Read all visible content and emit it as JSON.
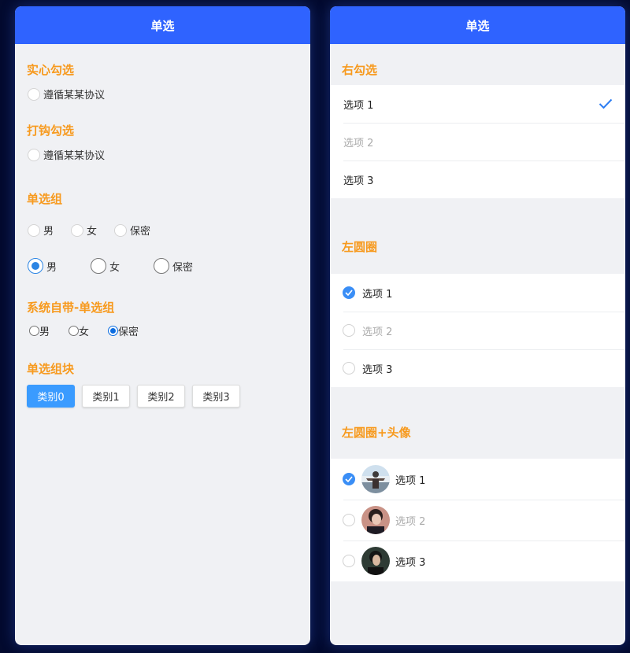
{
  "left": {
    "navbar_title": "单选",
    "solid_check": {
      "title": "实心勾选",
      "label": "遵循某某协议"
    },
    "tick_check": {
      "title": "打钩勾选",
      "label": "遵循某某协议"
    },
    "radio_group": {
      "title": "单选组",
      "small_options": [
        "男",
        "女",
        "保密"
      ],
      "large_options": [
        "男",
        "女",
        "保密"
      ],
      "large_selected": "男"
    },
    "system_group": {
      "title": "系统自带-单选组",
      "options": [
        "男",
        "女",
        "保密"
      ],
      "selected": "保密"
    },
    "block_group": {
      "title": "单选组块",
      "options": [
        "类别0",
        "类别1",
        "类别2",
        "类别3"
      ],
      "selected": "类别0"
    }
  },
  "right": {
    "navbar_title": "单选",
    "right_check": {
      "title": "右勾选",
      "options": [
        "选项 1",
        "选项 2",
        "选项 3"
      ],
      "selected": "选项 1",
      "disabled": "选项 2"
    },
    "left_circle": {
      "title": "左圆圈",
      "options": [
        "选项 1",
        "选项 2",
        "选项 3"
      ],
      "selected": "选项 1",
      "disabled": "选项 2"
    },
    "left_circle_avatar": {
      "title": "左圆圈+头像",
      "options": [
        "选项 1",
        "选项 2",
        "选项 3"
      ],
      "selected": "选项 1",
      "disabled": "选项 2"
    }
  },
  "colors": {
    "navbar": "#2f63ff",
    "section_title": "#f79a1e",
    "accent": "#3a8ef6",
    "background": "#030a2e"
  }
}
